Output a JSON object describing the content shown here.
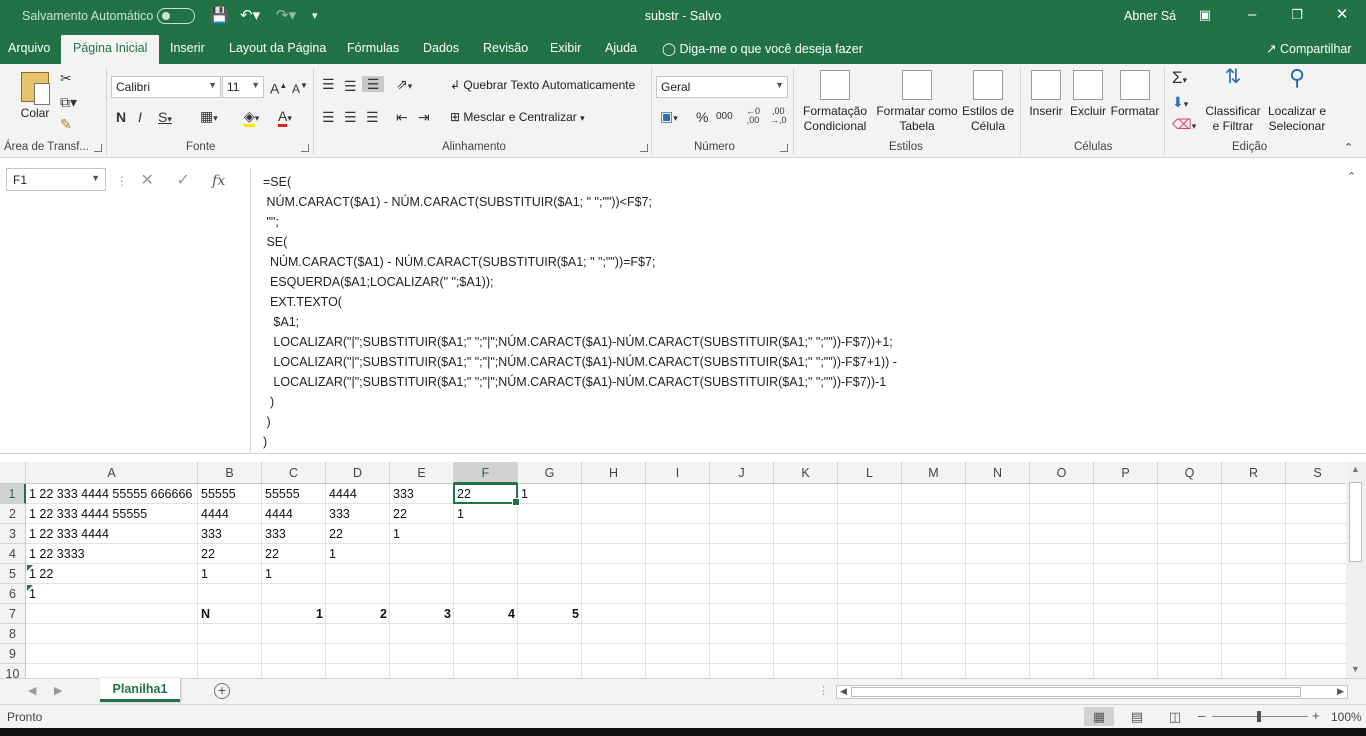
{
  "titlebar": {
    "autosave": "Salvamento Automático",
    "title": "substr  -  Salvo",
    "user": "Abner Sá"
  },
  "tabs": [
    "Arquivo",
    "Página Inicial",
    "Inserir",
    "Layout da Página",
    "Fórmulas",
    "Dados",
    "Revisão",
    "Exibir",
    "Ajuda"
  ],
  "tell_me": "Diga-me o que você deseja fazer",
  "share": "Compartilhar",
  "ribbon": {
    "clipboard": {
      "paste": "Colar",
      "label": "Área de Transf..."
    },
    "font": {
      "name": "Calibri",
      "size": "11",
      "label": "Fonte"
    },
    "alignment": {
      "wrap": "Quebrar Texto Automaticamente",
      "merge": "Mesclar e Centralizar",
      "label": "Alinhamento"
    },
    "number": {
      "format": "Geral",
      "label": "Número"
    },
    "styles": {
      "conditional": "Formatação Condicional",
      "table": "Formatar como Tabela",
      "cell": "Estilos de Célula",
      "label": "Estilos"
    },
    "cells": {
      "insert": "Inserir",
      "delete": "Excluir",
      "format": "Formatar",
      "label": "Células"
    },
    "editing": {
      "sort": "Classificar e Filtrar",
      "find": "Localizar e Selecionar",
      "label": "Edição"
    }
  },
  "formula_bar": {
    "name_box": "F1",
    "formula": "=SE(\n NÚM.CARACT($A1) - NÚM.CARACT(SUBSTITUIR($A1; \" \";\"\"))<F$7;\n \"\";\n SE(\n  NÚM.CARACT($A1) - NÚM.CARACT(SUBSTITUIR($A1; \" \";\"\"))=F$7;\n  ESQUERDA($A1;LOCALIZAR(\" \";$A1));\n  EXT.TEXTO(\n   $A1;\n   LOCALIZAR(\"|\";SUBSTITUIR($A1;\" \";\"|\";NÚM.CARACT($A1)-NÚM.CARACT(SUBSTITUIR($A1;\" \";\"\"))-F$7))+1;\n   LOCALIZAR(\"|\";SUBSTITUIR($A1;\" \";\"|\";NÚM.CARACT($A1)-NÚM.CARACT(SUBSTITUIR($A1;\" \";\"\"))-F$7+1)) -\n   LOCALIZAR(\"|\";SUBSTITUIR($A1;\" \";\"|\";NÚM.CARACT($A1)-NÚM.CARACT(SUBSTITUIR($A1;\" \";\"\"))-F$7))-1\n  )\n )\n)"
  },
  "grid": {
    "columns": [
      "A",
      "B",
      "C",
      "D",
      "E",
      "F",
      "G",
      "H",
      "I",
      "J",
      "K",
      "L",
      "M",
      "N",
      "O",
      "P",
      "Q",
      "R",
      "S"
    ],
    "rows": [
      "1",
      "2",
      "3",
      "4",
      "5",
      "6",
      "7",
      "8",
      "9",
      "10"
    ],
    "selected_cell": "F1",
    "cells": {
      "A1": "1 22 333 4444 55555 666666",
      "B1": "55555",
      "C1": "55555",
      "D1": "4444",
      "E1": "333",
      "F1": "22",
      "G1": "1",
      "A2": "1 22 333 4444 55555",
      "B2": "4444",
      "C2": "4444",
      "D2": "333",
      "E2": "22",
      "F2": "1",
      "A3": "1 22 333 4444",
      "B3": "333",
      "C3": "333",
      "D3": "22",
      "E3": "1",
      "A4": "1 22 3333",
      "B4": "22",
      "C4": "22",
      "D4": "1",
      "A5": "1 22",
      "B5": "1",
      "C5": "1",
      "A6": "1",
      "B7": "N",
      "C7": "1",
      "D7": "2",
      "E7": "3",
      "F7": "4",
      "G7": "5"
    }
  },
  "sheet_tab": "Planilha1",
  "status": {
    "ready": "Pronto",
    "zoom": "100%"
  }
}
